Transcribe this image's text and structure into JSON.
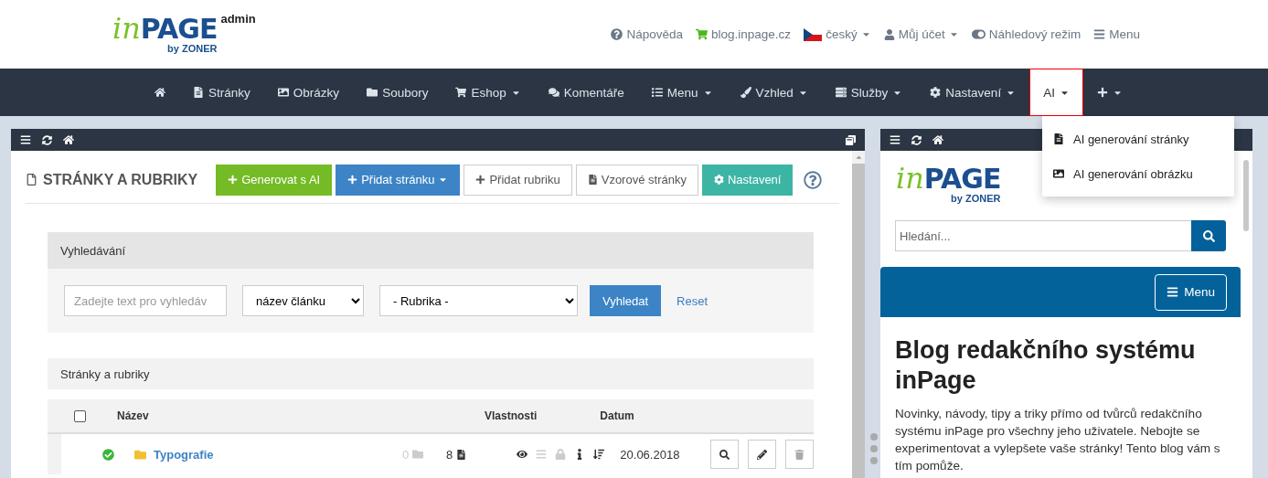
{
  "brand": {
    "logo_in": "in",
    "logo_page": "PAGE",
    "logo_by": "by ZONER",
    "label": "admin"
  },
  "top_links": [
    {
      "kind": "help",
      "label": "Nápověda",
      "dropdown": false
    },
    {
      "kind": "cart",
      "label": "blog.inpage.cz",
      "dropdown": false
    },
    {
      "kind": "flag",
      "label": "český",
      "dropdown": true
    },
    {
      "kind": "user",
      "label": "Můj účet",
      "dropdown": true
    },
    {
      "kind": "toggle",
      "label": "Náhledový režim",
      "dropdown": false
    },
    {
      "kind": "menu",
      "label": "Menu",
      "dropdown": false
    }
  ],
  "nav": [
    {
      "kind": "home",
      "selected": false,
      "dropdown": false
    },
    {
      "kind": "pages",
      "label": "Stránky",
      "selected": false,
      "dropdown": false
    },
    {
      "kind": "images",
      "label": "Obrázky",
      "selected": false,
      "dropdown": false
    },
    {
      "kind": "files",
      "label": "Soubory",
      "selected": false,
      "dropdown": false
    },
    {
      "kind": "shop",
      "label": "Eshop",
      "selected": false,
      "dropdown": true
    },
    {
      "kind": "comments",
      "label": "Komentáře",
      "selected": false,
      "dropdown": false
    },
    {
      "kind": "list",
      "label": "Menu",
      "selected": false,
      "dropdown": true
    },
    {
      "kind": "brush",
      "label": "Vzhled",
      "selected": false,
      "dropdown": true
    },
    {
      "kind": "server",
      "label": "Služby",
      "selected": false,
      "dropdown": true
    },
    {
      "kind": "gear",
      "label": "Nastavení",
      "selected": false,
      "dropdown": true
    },
    {
      "kind": "text",
      "label": "AI",
      "selected": true,
      "dropdown": true
    },
    {
      "kind": "plus",
      "selected": false,
      "dropdown": true
    }
  ],
  "dropdown_menu": [
    {
      "kind": "page",
      "label": "AI generování stránky"
    },
    {
      "kind": "image",
      "label": "AI generování obrázku"
    }
  ],
  "left_panel": {
    "title": "STRÁNKY A RUBRIKY",
    "buttons": [
      {
        "kind": "generate",
        "label": "Generovat s AI",
        "dropdown": false
      },
      {
        "kind": "add",
        "label": "Přidat stránku",
        "dropdown": true
      },
      {
        "kind": "addsection",
        "label": "Přidat rubriku",
        "dropdown": false
      },
      {
        "kind": "templates",
        "label": "Vzorové stránky",
        "dropdown": false
      },
      {
        "kind": "settings",
        "label": "Nastavení",
        "dropdown": false
      }
    ],
    "search": {
      "title": "Vyhledávání",
      "placeholder": "Zadejte text pro vyhledáv",
      "field_select": "název článku",
      "category_select": "- Rubrika -",
      "submit": "Vyhledat",
      "reset": "Reset"
    },
    "table": {
      "title": "Stránky a rubriky",
      "select_all": false,
      "columns": [
        "Název",
        "Vlastnosti",
        "Datum"
      ],
      "rows": [
        {
          "published": true,
          "name": "Typografie",
          "folders": "0",
          "pages": "8",
          "date": "20.06.2018",
          "properties": [
            {
              "kind": "eye",
              "on": true
            },
            {
              "kind": "list",
              "on": false
            },
            {
              "kind": "lock",
              "on": false
            },
            {
              "kind": "info",
              "on": true
            },
            {
              "kind": "order",
              "on": true
            }
          ]
        }
      ]
    }
  },
  "preview": {
    "logo_in": "in",
    "logo_page": "PAGE",
    "logo_by": "by ZONER",
    "search_placeholder": "Hledání...",
    "menu_button": "Menu",
    "heading": "Blog redakčního systému inPage",
    "text": "Novinky, návody, tipy a triky přímo od tvůrců redakčního systému inPage pro všechny jeho uživatele. Nebojte se experimentovat a vylepšete vaše stránky! Tento blog vám s tím pomůže."
  }
}
